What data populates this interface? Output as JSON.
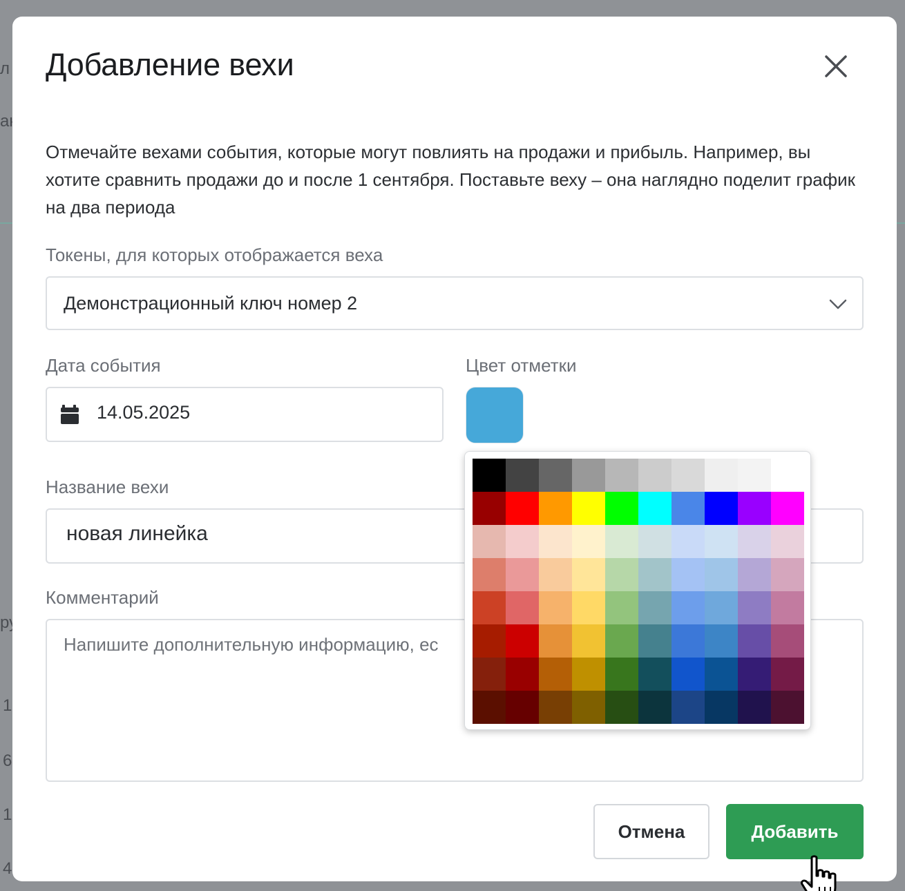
{
  "modal": {
    "title": "Добавление вехи",
    "description": "Отмечайте вехами события, которые могут повлиять на продажи и прибыль. Например, вы хотите сравнить продажи до и после 1 сентября. Поставьте веху – она наглядно поделит график на два периода"
  },
  "tokens": {
    "label": "Токены, для которых отображается веха",
    "selected": "Демонстрационный ключ номер 2"
  },
  "date": {
    "label": "Дата события",
    "value": "14.05.2025"
  },
  "color": {
    "label": "Цвет отметки",
    "selected": "#46a8d9",
    "palette": [
      [
        "#000000",
        "#434343",
        "#666666",
        "#999999",
        "#b7b7b7",
        "#cccccc",
        "#d9d9d9",
        "#efefef",
        "#f3f3f3",
        "#ffffff"
      ],
      [
        "#980000",
        "#ff0000",
        "#ff9900",
        "#ffff00",
        "#00ff00",
        "#00ffff",
        "#4a86e8",
        "#0000ff",
        "#9900ff",
        "#ff00ff"
      ],
      [
        "#e6b8af",
        "#f4cccc",
        "#fce5cd",
        "#fff2cc",
        "#d9ead3",
        "#d0e0e3",
        "#c9daf8",
        "#cfe2f3",
        "#d9d2e9",
        "#ead1dc"
      ],
      [
        "#dd7e6b",
        "#ea9999",
        "#f9cb9c",
        "#ffe599",
        "#b6d7a8",
        "#a2c4c9",
        "#a4c2f4",
        "#9fc5e8",
        "#b4a7d6",
        "#d5a6bd"
      ],
      [
        "#cc4125",
        "#e06666",
        "#f6b26b",
        "#ffd966",
        "#93c47d",
        "#76a5af",
        "#6d9eeb",
        "#6fa8dc",
        "#8e7cc3",
        "#c27ba0"
      ],
      [
        "#a61c00",
        "#cc0000",
        "#e69138",
        "#f1c232",
        "#6aa84f",
        "#45818e",
        "#3c78d8",
        "#3d85c6",
        "#674ea7",
        "#a64d79"
      ],
      [
        "#85200c",
        "#990000",
        "#b45f06",
        "#bf9000",
        "#38761d",
        "#134f5c",
        "#1155cc",
        "#0b5394",
        "#351c75",
        "#741b47"
      ],
      [
        "#5b0f00",
        "#660000",
        "#783f04",
        "#7f6000",
        "#274e13",
        "#0c343d",
        "#1c4587",
        "#073763",
        "#20124d",
        "#4c1130"
      ]
    ]
  },
  "name": {
    "label": "Название вехи",
    "value": "новая линейка"
  },
  "comment": {
    "label": "Комментарий",
    "placeholder": "Напишите дополнительную информацию, ес"
  },
  "actions": {
    "cancel": "Отмена",
    "add": "Добавить"
  },
  "icons": {
    "close": "close-icon",
    "dropdown": "chevron-down-icon",
    "calendar": "calendar-icon",
    "cursor": "hand-pointer-cursor-icon"
  },
  "background_fragments": [
    "л",
    "ак",
    "ру",
    "1",
    "6",
    "1",
    "4"
  ]
}
